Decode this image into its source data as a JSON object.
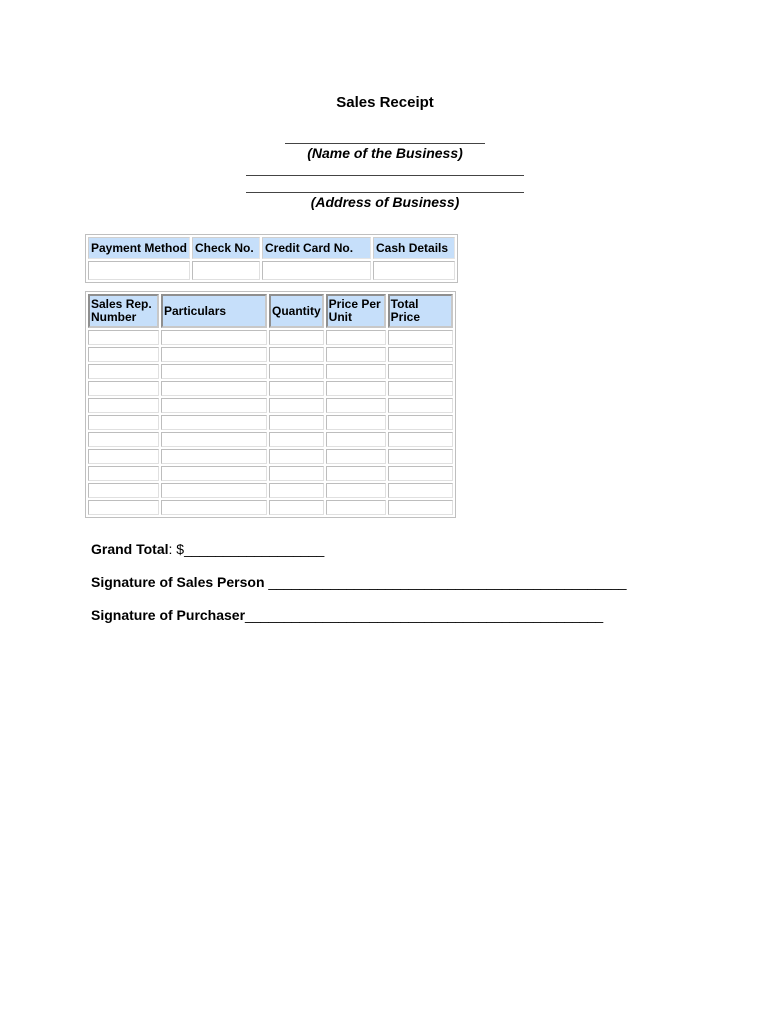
{
  "title": "Sales Receipt",
  "business_name_caption": "(Name of the Business)",
  "business_address_caption": "(Address of Business)",
  "payment_table": {
    "headers": [
      "Payment Method",
      "Check No.",
      "Credit Card No.",
      "Cash Details"
    ],
    "rows": [
      [
        "",
        "",
        "",
        ""
      ]
    ]
  },
  "items_table": {
    "headers": [
      "Sales Rep. Number",
      "Particulars",
      "Quantity",
      "Price Per Unit",
      "Total Price"
    ],
    "row_count": 11
  },
  "grand_total": {
    "label": "Grand Total",
    "suffix": ": $__________________"
  },
  "signature_sales_person": {
    "label": "Signature of Sales Person",
    "blank": " ______________________________________________"
  },
  "signature_purchaser": {
    "label": "Signature of Purchaser",
    "blank": "______________________________________________"
  }
}
